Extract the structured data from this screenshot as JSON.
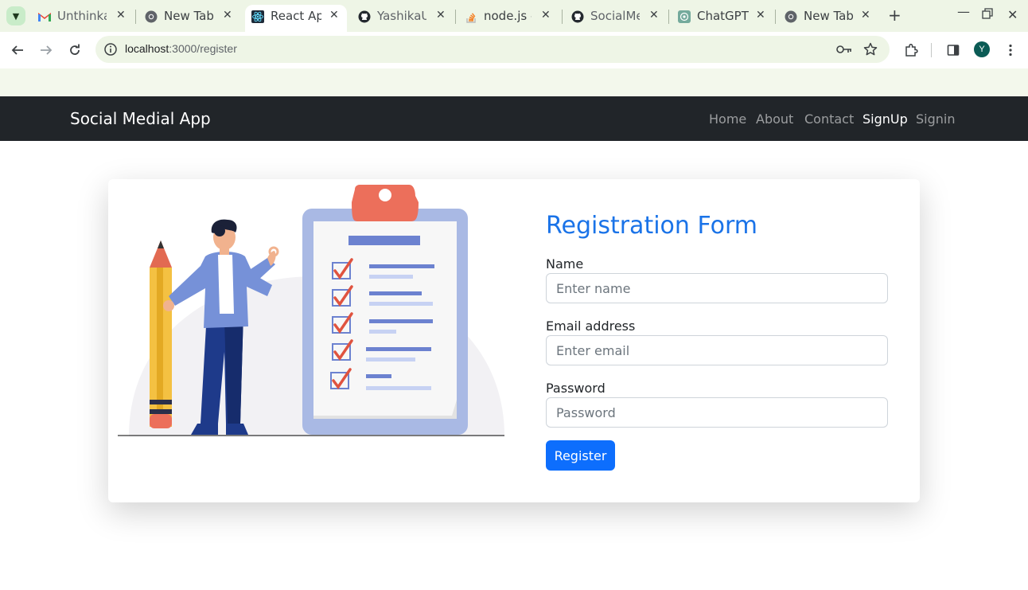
{
  "browser": {
    "tabs": [
      {
        "title": "Unthinka",
        "icon": "gmail-icon"
      },
      {
        "title": "New Tab",
        "icon": "chrome-icon"
      },
      {
        "title": "React App",
        "icon": "react-icon",
        "active": true
      },
      {
        "title": "YashikaU",
        "icon": "github-icon"
      },
      {
        "title": "node.js -",
        "icon": "stackoverflow-icon"
      },
      {
        "title": "SocialMe",
        "icon": "github-icon"
      },
      {
        "title": "ChatGPT",
        "icon": "chatgpt-icon"
      },
      {
        "title": "New Tab",
        "icon": "chrome-icon"
      }
    ],
    "url_host": "localhost",
    "url_path": ":3000/register",
    "avatar_letter": "Y"
  },
  "navbar": {
    "brand": "Social Medial App",
    "links": [
      "Home",
      "About",
      "Contact",
      "SignUp",
      "Signin"
    ],
    "active_link": "SignUp"
  },
  "form": {
    "title": "Registration Form",
    "name_label": "Name",
    "name_placeholder": "Enter name",
    "email_label": "Email address",
    "email_placeholder": "Enter email",
    "password_label": "Password",
    "password_placeholder": "Password",
    "submit_label": "Register"
  },
  "colors": {
    "accent": "#0d6efd",
    "title": "#1a73e8",
    "navbar_bg": "#212529"
  }
}
